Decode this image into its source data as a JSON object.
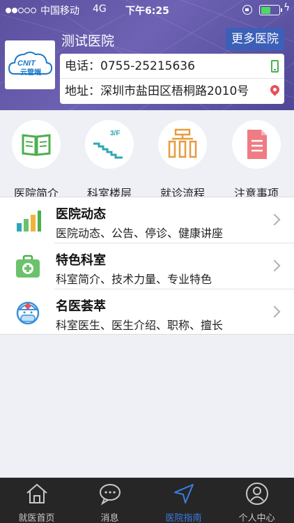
{
  "status_bar": {
    "carrier": "中国移动",
    "network": "4G",
    "time": "下午6:25",
    "signal_bars_filled": 2,
    "battery_level": 0.55
  },
  "header": {
    "hospital_name": "测试医院",
    "more_button_label": "更多医院",
    "logo_text": "云管端",
    "logo_mark": "CNIT",
    "phone_line": "电话：0755-25215636",
    "address_line": "地址：深圳市盐田区梧桐路2010号"
  },
  "quick_links": [
    {
      "label": "医院简介",
      "icon": "book-icon"
    },
    {
      "label": "科室楼层",
      "icon": "stairs-icon",
      "floor_text": "3/F"
    },
    {
      "label": "就诊流程",
      "icon": "flowchart-icon"
    },
    {
      "label": "注意事项",
      "icon": "document-icon"
    }
  ],
  "list": [
    {
      "title": "医院动态",
      "desc": "医院动态、公告、停诊、健康讲座",
      "icon": "bar-chart-icon"
    },
    {
      "title": "特色科室",
      "desc": "科室简介、技术力量、专业特色",
      "icon": "medical-kit-icon"
    },
    {
      "title": "名医荟萃",
      "desc": "科室医生、医生介绍、职称、擅长",
      "icon": "doctor-icon"
    }
  ],
  "tabs": [
    {
      "label": "就医首页",
      "icon": "home-icon",
      "active": false
    },
    {
      "label": "消息",
      "icon": "message-icon",
      "active": false
    },
    {
      "label": "医院指南",
      "icon": "navigation-icon",
      "active": true
    },
    {
      "label": "个人中心",
      "icon": "user-icon",
      "active": false
    }
  ],
  "colors": {
    "header_bg": "#5b4f9e",
    "more_button_bg": "#3c5fb7",
    "active_tab": "#3d7de0",
    "tabbar_bg": "#262626",
    "green": "#4caf50",
    "orange": "#e89a3c",
    "teal": "#2ea7b5",
    "red": "#e8505b"
  }
}
